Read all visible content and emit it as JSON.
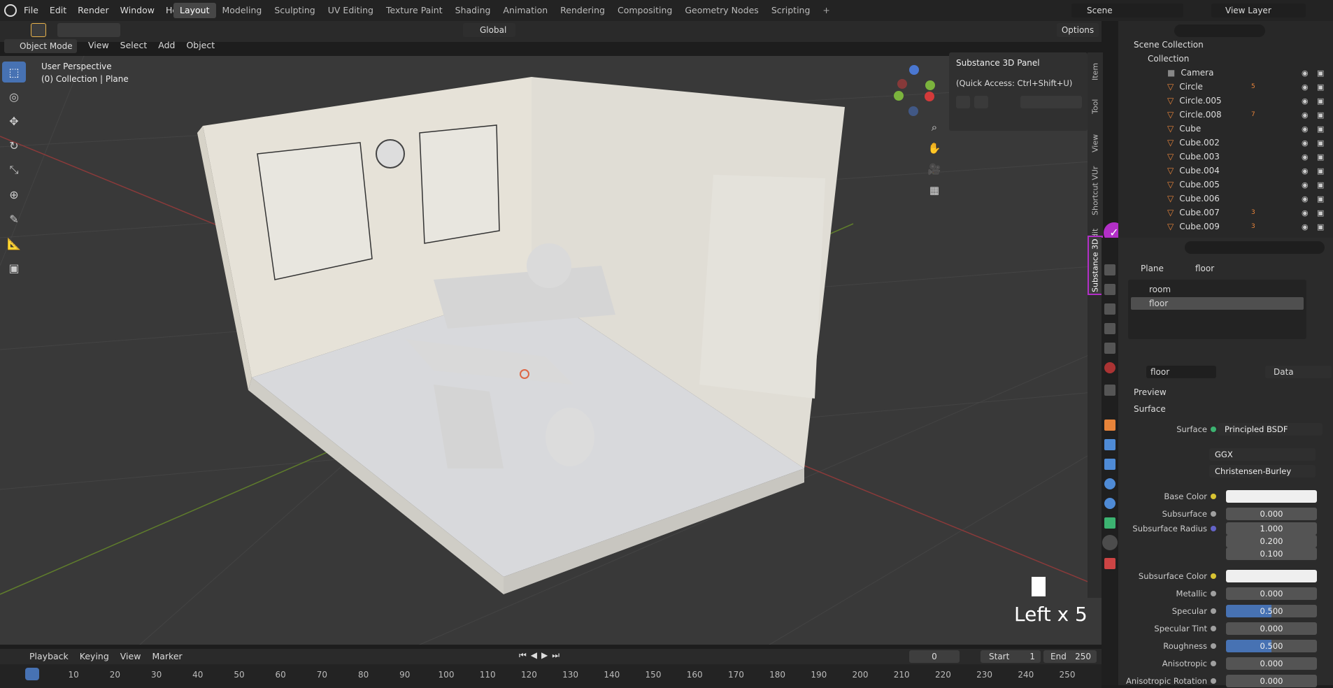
{
  "topbar": {
    "menus": [
      "File",
      "Edit",
      "Render",
      "Window",
      "Help"
    ],
    "workspaces": [
      "Layout",
      "Modeling",
      "Sculpting",
      "UV Editing",
      "Texture Paint",
      "Shading",
      "Animation",
      "Rendering",
      "Compositing",
      "Geometry Nodes",
      "Scripting"
    ],
    "active_workspace": "Layout",
    "scene": "Scene",
    "view_layer": "View Layer"
  },
  "viewport_header": {
    "mode": "Object Mode",
    "menus": [
      "View",
      "Select",
      "Add",
      "Object"
    ],
    "transform": "Global",
    "options": "Options"
  },
  "viewport": {
    "perspective": "User Perspective",
    "collection": "(0) Collection | Plane",
    "key_overlay": "Left x 5"
  },
  "side_tabs": [
    "Item",
    "Tool",
    "View",
    "Shortcut VUr",
    "Edit",
    "Substance 3D"
  ],
  "substance_panel": {
    "title": "Substance 3D Panel",
    "quick_access": "(Quick Access: Ctrl+Shift+U)"
  },
  "outliner": {
    "root": "Scene Collection",
    "collection": "Collection",
    "items": [
      {
        "name": "Camera"
      },
      {
        "name": "Circle",
        "badge": "5"
      },
      {
        "name": "Circle.005"
      },
      {
        "name": "Circle.008",
        "badge": "7"
      },
      {
        "name": "Cube"
      },
      {
        "name": "Cube.002"
      },
      {
        "name": "Cube.003"
      },
      {
        "name": "Cube.004"
      },
      {
        "name": "Cube.005"
      },
      {
        "name": "Cube.006"
      },
      {
        "name": "Cube.007",
        "badge": "3"
      },
      {
        "name": "Cube.009",
        "badge": "3"
      }
    ]
  },
  "properties": {
    "object": "Plane",
    "material": "floor",
    "slots": [
      "room",
      "floor"
    ],
    "active_slot": "floor",
    "material_name": "floor",
    "link": "Data",
    "sections": {
      "preview": "Preview",
      "surface": "Surface"
    },
    "surface_shader": "Principled BSDF",
    "distribution": "GGX",
    "subsurface_method": "Christensen-Burley",
    "fields": [
      {
        "label": "Base Color",
        "value": "",
        "dot": "#d8c332",
        "kind": "color"
      },
      {
        "label": "Subsurface",
        "value": "0.000",
        "dot": "#a0a0a0"
      },
      {
        "label": "Subsurface Radius",
        "value": "1.000",
        "dot": "#6363c7"
      },
      {
        "label": "",
        "value": "0.200",
        "dot": ""
      },
      {
        "label": "",
        "value": "0.100",
        "dot": ""
      },
      {
        "label": "Subsurface Color",
        "value": "",
        "dot": "#d8c332",
        "kind": "color"
      },
      {
        "label": "Metallic",
        "value": "0.000",
        "dot": "#a0a0a0"
      },
      {
        "label": "Specular",
        "value": "0.500",
        "dot": "#a0a0a0",
        "fill": 0.5
      },
      {
        "label": "Specular Tint",
        "value": "0.000",
        "dot": "#a0a0a0"
      },
      {
        "label": "Roughness",
        "value": "0.500",
        "dot": "#a0a0a0",
        "fill": 0.5
      },
      {
        "label": "Anisotropic",
        "value": "0.000",
        "dot": "#a0a0a0"
      },
      {
        "label": "Anisotropic Rotation",
        "value": "0.000",
        "dot": "#a0a0a0"
      }
    ]
  },
  "timeline": {
    "menus": [
      "Playback",
      "Keying",
      "View",
      "Marker"
    ],
    "current_frame": "0",
    "start_label": "Start",
    "start": "1",
    "end_label": "End",
    "end": "250",
    "ticks": [
      "0",
      "10",
      "20",
      "30",
      "40",
      "50",
      "60",
      "70",
      "80",
      "90",
      "100",
      "110",
      "120",
      "130",
      "140",
      "150",
      "160",
      "170",
      "180",
      "190",
      "200",
      "210",
      "220",
      "230",
      "240",
      "250"
    ]
  },
  "colors": {
    "accent": "#4772b3",
    "highlight": "#b22fc7",
    "object_orange": "#e8843a"
  }
}
